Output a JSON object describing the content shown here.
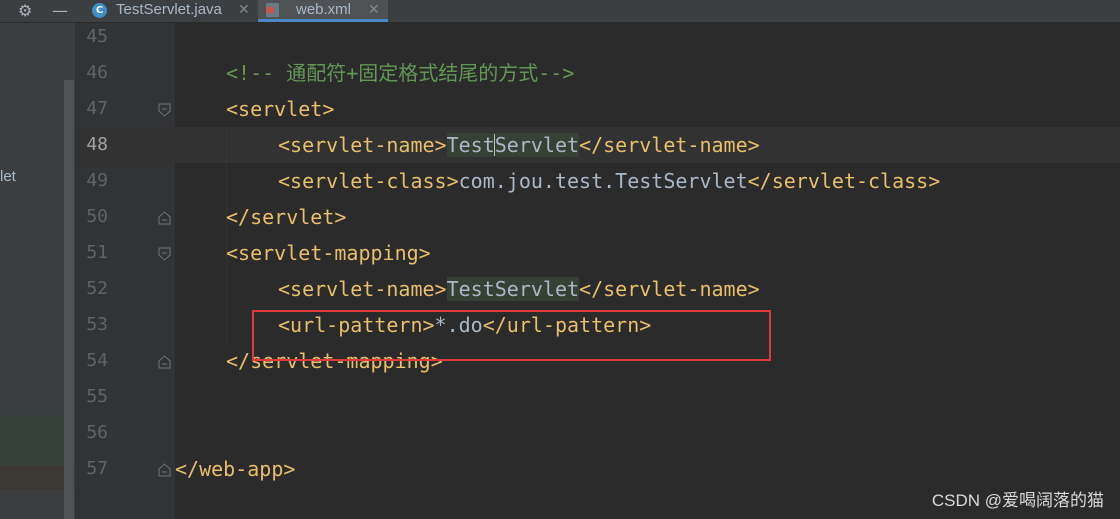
{
  "toolbar": {
    "settings_icon": "gear-icon",
    "minimize_icon": "minimize-icon"
  },
  "tabs": [
    {
      "label": "TestServlet.java",
      "icon": "java-class-icon",
      "active": false
    },
    {
      "label": "web.xml",
      "icon": "xml-file-icon",
      "active": true
    }
  ],
  "left_panel": {
    "label": "let"
  },
  "editor": {
    "current_line": 48,
    "lines": [
      {
        "num": "45"
      },
      {
        "num": "46",
        "comment": "<!-- 通配符+固定格式结尾的方式-->"
      },
      {
        "num": "47",
        "open": "<servlet>"
      },
      {
        "num": "48",
        "open": "<servlet-name>",
        "text_a": "Test",
        "text_b": "Servlet",
        "close": "</servlet-name>"
      },
      {
        "num": "49",
        "open": "<servlet-class>",
        "text": "com.jou.test.TestServlet",
        "close": "</servlet-class>"
      },
      {
        "num": "50",
        "close": "</servlet>"
      },
      {
        "num": "51",
        "open": "<servlet-mapping>"
      },
      {
        "num": "52",
        "open": "<servlet-name>",
        "text": "TestServlet",
        "close": "</servlet-name>"
      },
      {
        "num": "53",
        "open": "<url-pattern>",
        "text": "*.do",
        "close": "</url-pattern>"
      },
      {
        "num": "54",
        "close": "</servlet-mapping>"
      },
      {
        "num": "55"
      },
      {
        "num": "56"
      },
      {
        "num": "57",
        "close": "</web-app>"
      }
    ]
  },
  "colors": {
    "tag": "#e8bf6a",
    "text": "#a9b7c6",
    "comment": "#629755",
    "annotation_box": "#e0393b"
  },
  "watermark": "CSDN @爱喝阔落的猫"
}
